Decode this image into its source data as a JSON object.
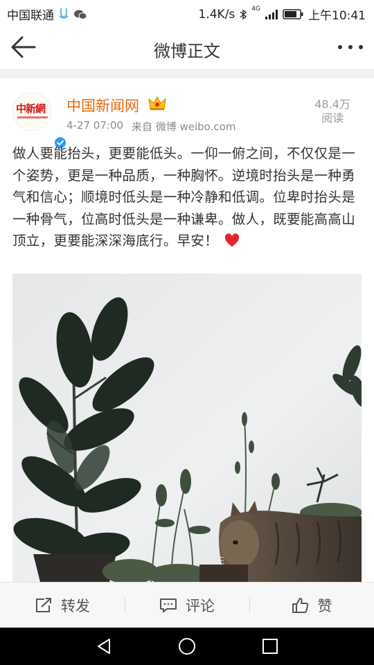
{
  "status_bar": {
    "carrier": "中国联通",
    "speed": "1.4K/s",
    "network": "4G",
    "time": "上午10:41"
  },
  "nav": {
    "title": "微博正文"
  },
  "post": {
    "user_name": "中国新闻网",
    "avatar_text": "中新網",
    "timestamp": "4-27 07:00",
    "source": "来自 微博 weibo.com",
    "views_count": "48.4万",
    "views_label": "阅读",
    "text": "做人要能抬头，更要能低头。一仰一俯之间，不仅仅是一个姿势，更是一种品质，一种胸怀。逆境时抬头是一种勇气和信心；顺境时低头是一种冷静和低调。位卑时抬头是一种骨气，位高时低头是一种谦卑。做人，既要能高高山顶立，更要能深深海底行。早安！"
  },
  "actions": {
    "repost": "转发",
    "comment": "评论",
    "like": "赞"
  },
  "colors": {
    "username": "#e8680a",
    "verified": "#2a9bf2",
    "heart": "#e0272f"
  },
  "icons": [
    "back-arrow-icon",
    "more-icon",
    "crown-icon",
    "verified-icon",
    "heart-icon",
    "repost-icon",
    "comment-icon",
    "like-icon",
    "nav-back-icon",
    "nav-home-icon",
    "nav-recent-icon"
  ]
}
